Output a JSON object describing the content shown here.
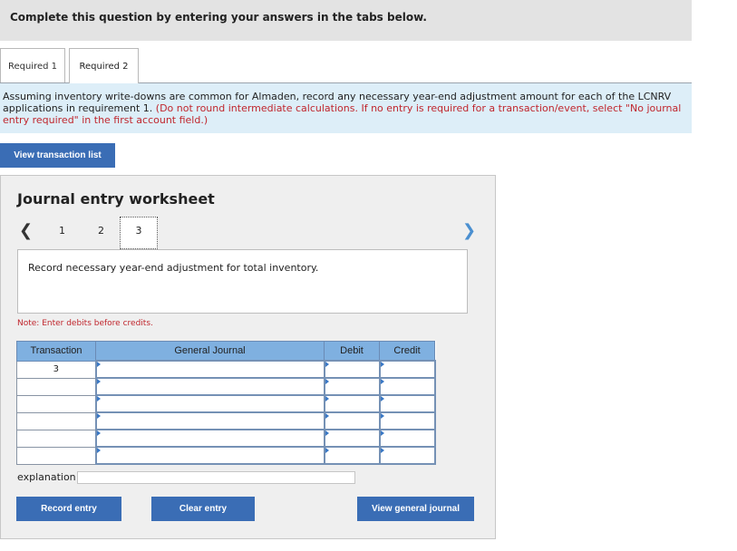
{
  "header": {
    "instruction": "Complete this question by entering your answers in the tabs below."
  },
  "tabs": [
    {
      "label": "Required 1"
    },
    {
      "label": "Required 2"
    }
  ],
  "instructions": {
    "main": "Assuming inventory write-downs are common for Almaden, record any necessary year-end adjustment amount for each of the LCNRV applications in requirement 1.",
    "red": "(Do not round intermediate calculations. If no entry is required for a transaction/event, select \"No journal entry required\" in the first account field.)"
  },
  "view_transaction_button": "View transaction list",
  "worksheet": {
    "title": "Journal entry worksheet",
    "pages": [
      "1",
      "2",
      "3"
    ],
    "current_page": "3",
    "description": "Record necessary year-end adjustment for total inventory.",
    "note": "Note: Enter debits before credits.",
    "table": {
      "headers": [
        "Transaction",
        "General Journal",
        "Debit",
        "Credit"
      ],
      "rows": [
        {
          "transaction": "3",
          "account": "",
          "debit": "",
          "credit": ""
        },
        {
          "transaction": "",
          "account": "",
          "debit": "",
          "credit": ""
        },
        {
          "transaction": "",
          "account": "",
          "debit": "",
          "credit": ""
        },
        {
          "transaction": "",
          "account": "",
          "debit": "",
          "credit": ""
        },
        {
          "transaction": "",
          "account": "",
          "debit": "",
          "credit": ""
        },
        {
          "transaction": "",
          "account": "",
          "debit": "",
          "credit": ""
        }
      ]
    },
    "explanation_label": "explanation",
    "explanation_value": "",
    "buttons": {
      "record": "Record entry",
      "clear": "Clear entry",
      "view_general": "View general journal"
    }
  },
  "icons": {
    "prev": "chevron-left-icon",
    "next": "chevron-right-icon"
  },
  "colors": {
    "button_blue": "#3a6db5",
    "header_blue": "#7fb0e0",
    "note_red": "#c0262d",
    "instruction_bg": "#ddeef8"
  }
}
